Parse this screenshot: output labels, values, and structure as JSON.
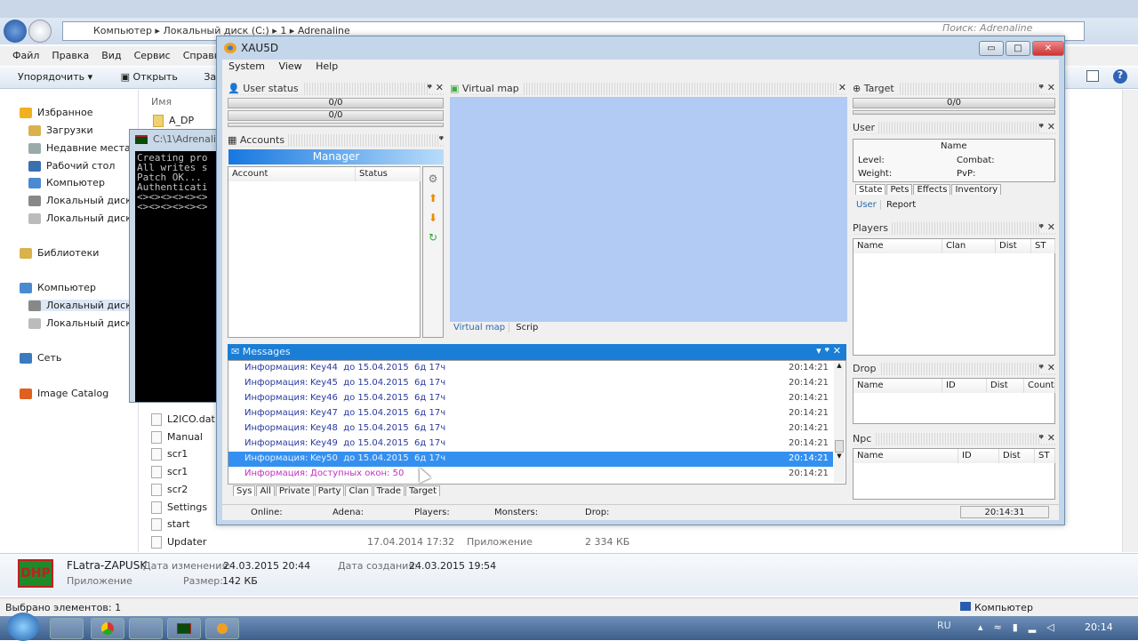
{
  "explorer": {
    "breadcrumb": [
      "Компьютер",
      "Локальный диск (C:)",
      "1",
      "Adrenaline"
    ],
    "search_placeholder": "Поиск: Adrenaline",
    "menu": [
      "Файл",
      "Правка",
      "Вид",
      "Сервис",
      "Справка"
    ],
    "toolbar": {
      "organize": "Упорядочить",
      "open": "Открыть",
      "burn": "Запи"
    },
    "sidebar": [
      {
        "label": "Избранное",
        "icon": "star-icon",
        "color": "#f0b020"
      },
      {
        "label": "Загрузки",
        "icon": "downloads-icon",
        "color": "#d9b24c"
      },
      {
        "label": "Недавние места",
        "icon": "recent-places-icon",
        "color": "#9aa"
      },
      {
        "label": "Рабочий стол",
        "icon": "desktop-icon",
        "color": "#3a6fb0"
      },
      {
        "label": "Компьютер",
        "icon": "computer-icon",
        "color": "#4a8ad0"
      },
      {
        "label": "Локальный диск (",
        "icon": "drive-icon",
        "color": "#888"
      },
      {
        "label": "Локальный диск (",
        "icon": "drive-icon",
        "color": "#bbb"
      },
      {
        "label": "Библиотеки",
        "icon": "libraries-icon",
        "color": "#d9b24c"
      },
      {
        "label": "Компьютер",
        "icon": "computer-icon",
        "color": "#4a8ad0"
      },
      {
        "label": "Локальный диск (",
        "icon": "drive-icon",
        "color": "#888"
      },
      {
        "label": "Локальный диск (",
        "icon": "drive-icon",
        "color": "#bbb"
      },
      {
        "label": "Сеть",
        "icon": "network-icon",
        "color": "#3a7ac0"
      },
      {
        "label": "Image Catalog",
        "icon": "image-catalog-icon",
        "color": "#e06020"
      }
    ],
    "column_name": "Имя",
    "files": [
      "A_DP",
      "L2ICO.dat",
      "Manual",
      "scr1",
      "scr1",
      "scr2",
      "Settings",
      "start",
      "Updater"
    ],
    "updater_row": {
      "date": "17.04.2014 17:32",
      "type": "Приложение",
      "size": "2 334 КБ"
    },
    "details": {
      "name": "FLatra-ZAPUSK",
      "type": "Приложение",
      "modified_label": "Дата изменения:",
      "modified": "24.03.2015 20:44",
      "created_label": "Дата создания:",
      "created": "24.03.2015 19:54",
      "size_label": "Размер:",
      "size": "142 КБ",
      "logo_text": "DHP"
    },
    "status": "Выбрано элементов: 1",
    "status_right": "Компьютер"
  },
  "console": {
    "title": "C:\\1\\Adrenalin",
    "lines": [
      "Creating pro",
      "All writes s",
      "Patch OK...",
      "Authenticati",
      "<><><><><><>",
      "<><><><><><>"
    ]
  },
  "app": {
    "title": "XAU5D",
    "menu": [
      "System",
      "View",
      "Help"
    ],
    "user_status": {
      "title": "User status",
      "bars": [
        "0/0",
        "0/0"
      ]
    },
    "accounts": {
      "title": "Accounts",
      "manager": "Manager",
      "columns": [
        "Account",
        "Status"
      ]
    },
    "virtual_map": {
      "title": "Virtual map",
      "tabs": [
        "Virtual map",
        "Scrip"
      ],
      "color": "#b2cbf5"
    },
    "target": {
      "title": "Target",
      "bar": "0/0"
    },
    "user": {
      "title": "User",
      "name": "Name",
      "level": "Level:",
      "combat": "Combat:",
      "weight": "Weight:",
      "pvp": "PvP:",
      "tabs": [
        "State",
        "Pets",
        "Effects",
        "Inventory"
      ],
      "subtabs": [
        "User",
        "Report"
      ]
    },
    "players": {
      "title": "Players",
      "columns": [
        "Name",
        "Clan",
        "Dist",
        "ST"
      ]
    },
    "drop": {
      "title": "Drop",
      "columns": [
        "Name",
        "ID",
        "Dist",
        "Count"
      ]
    },
    "npc": {
      "title": "Npc",
      "columns": [
        "Name",
        "ID",
        "Dist",
        "ST"
      ]
    },
    "messages": {
      "title": "Messages",
      "rows": [
        {
          "type": "Информация:",
          "text": "Key44  до 15.04.2015  6д 17ч",
          "time": "20:14:21"
        },
        {
          "type": "Информация:",
          "text": "Key45  до 15.04.2015  6д 17ч",
          "time": "20:14:21"
        },
        {
          "type": "Информация:",
          "text": "Key46  до 15.04.2015  6д 17ч",
          "time": "20:14:21"
        },
        {
          "type": "Информация:",
          "text": "Key47  до 15.04.2015  6д 17ч",
          "time": "20:14:21"
        },
        {
          "type": "Информация:",
          "text": "Key48  до 15.04.2015  6д 17ч",
          "time": "20:14:21"
        },
        {
          "type": "Информация:",
          "text": "Key49  до 15.04.2015  6д 17ч",
          "time": "20:14:21"
        },
        {
          "type": "Информация:",
          "text": "Key50  до 15.04.2015  6д 17ч",
          "time": "20:14:21",
          "selected": true
        },
        {
          "type": "Информация:",
          "text": "Доступных окон: 50",
          "time": "20:14:21",
          "highlight": "#c030c0"
        }
      ],
      "tabs": [
        "Sys",
        "All",
        "Private",
        "Party",
        "Clan",
        "Trade",
        "Target"
      ]
    },
    "statusbar": {
      "online": "Online:",
      "adena": "Adena:",
      "players": "Players:",
      "monsters": "Monsters:",
      "drop": "Drop:",
      "time": "20:14:31"
    }
  },
  "taskbar": {
    "lang": "RU",
    "clock": "20:14"
  }
}
